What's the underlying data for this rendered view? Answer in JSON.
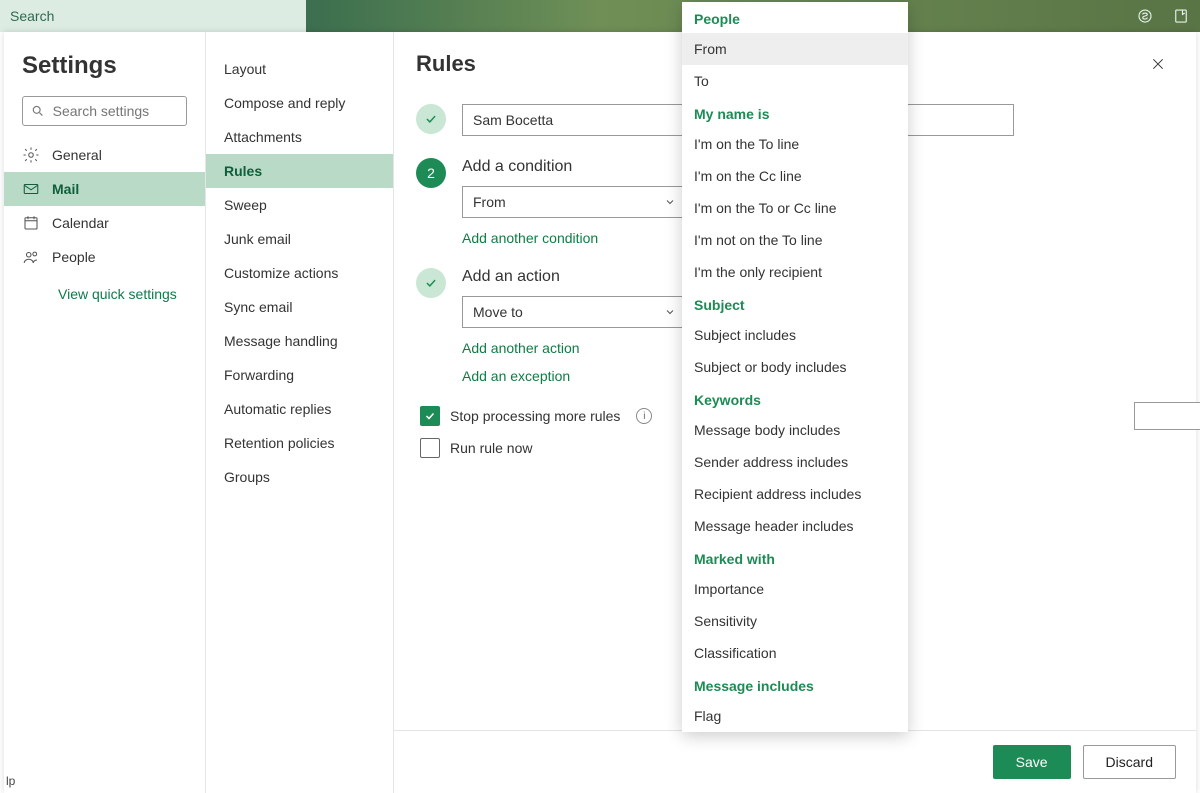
{
  "topbar": {
    "search": "Search"
  },
  "settings_title": "Settings",
  "search_placeholder": "Search settings",
  "nav1": [
    {
      "icon": "gear",
      "label": "General"
    },
    {
      "icon": "mail",
      "label": "Mail"
    },
    {
      "icon": "calendar",
      "label": "Calendar"
    },
    {
      "icon": "people",
      "label": "People"
    }
  ],
  "nav1_active": 1,
  "quick_link": "View quick settings",
  "nav2": [
    "Layout",
    "Compose and reply",
    "Attachments",
    "Rules",
    "Sweep",
    "Junk email",
    "Customize actions",
    "Sync email",
    "Message handling",
    "Forwarding",
    "Automatic replies",
    "Retention policies",
    "Groups"
  ],
  "nav2_active": 3,
  "page_title": "Rules",
  "rule_name": "Sam Bocetta",
  "step2_title": "Add a condition",
  "condition_value": "From",
  "add_condition": "Add another condition",
  "step3_title": "Add an action",
  "action_value": "Move to",
  "add_action": "Add another action",
  "add_exception": "Add an exception",
  "check_stop": "Stop processing more rules",
  "check_run": "Run rule now",
  "save": "Save",
  "discard": "Discard",
  "strip": "lp",
  "dropdown": {
    "selected": "From",
    "groups": [
      {
        "header": "People",
        "items": [
          "From",
          "To"
        ]
      },
      {
        "header": "My name is",
        "items": [
          "I'm on the To line",
          "I'm on the Cc line",
          "I'm on the To or Cc line",
          "I'm not on the To line",
          "I'm the only recipient"
        ]
      },
      {
        "header": "Subject",
        "items": [
          "Subject includes",
          "Subject or body includes"
        ]
      },
      {
        "header": "Keywords",
        "items": [
          "Message body includes",
          "Sender address includes",
          "Recipient address includes",
          "Message header includes"
        ]
      },
      {
        "header": "Marked with",
        "items": [
          "Importance",
          "Sensitivity",
          "Classification"
        ]
      },
      {
        "header": "Message includes",
        "items": [
          "Flag"
        ]
      }
    ]
  }
}
